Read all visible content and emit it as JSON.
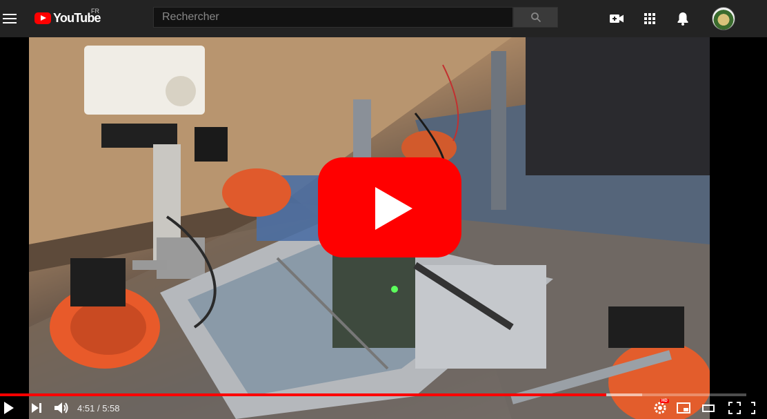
{
  "masthead": {
    "logo_text": "YouTube",
    "region": "FR",
    "search_placeholder": "Rechercher",
    "icons": [
      "menu-icon",
      "search-icon",
      "create-video-icon",
      "apps-grid-icon",
      "notifications-bell-icon",
      "avatar"
    ]
  },
  "player": {
    "current_time": "4:51",
    "separator": "/",
    "duration": "5:58",
    "played_fraction": 0.8128,
    "loaded_fraction": 0.86,
    "hd_label": "HD",
    "accent_color": "#ff0000"
  }
}
